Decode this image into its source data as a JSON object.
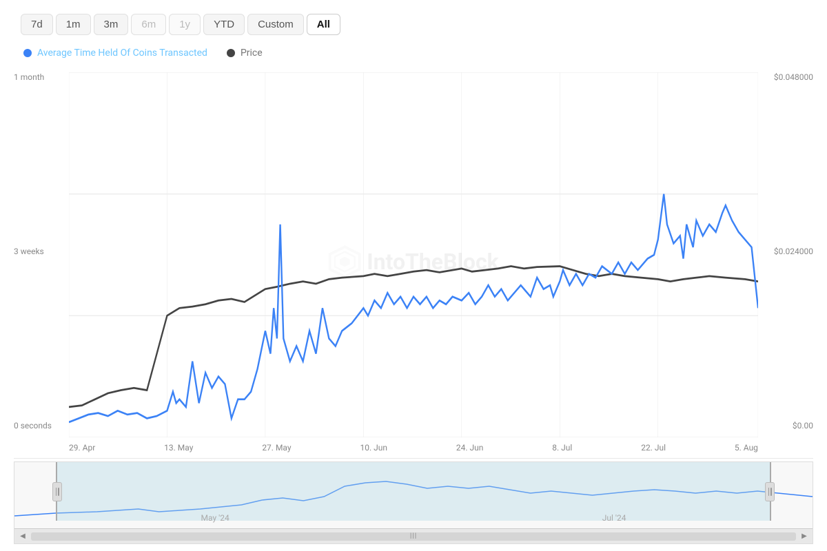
{
  "timeRange": {
    "buttons": [
      {
        "label": "7d",
        "state": "normal"
      },
      {
        "label": "1m",
        "state": "normal"
      },
      {
        "label": "3m",
        "state": "normal"
      },
      {
        "label": "6m",
        "state": "disabled"
      },
      {
        "label": "1y",
        "state": "disabled"
      },
      {
        "label": "YTD",
        "state": "normal"
      },
      {
        "label": "Custom",
        "state": "normal"
      },
      {
        "label": "All",
        "state": "active"
      }
    ]
  },
  "legend": {
    "series1_label": "Average Time Held Of Coins Transacted",
    "series2_label": "Price"
  },
  "yAxisLeft": {
    "labels": [
      "1 month",
      "3 weeks",
      "0 seconds"
    ]
  },
  "yAxisRight": {
    "labels": [
      "$0.048000",
      "$0.024000",
      "$0.00"
    ]
  },
  "xAxisLabels": [
    "29. Apr",
    "13. May",
    "27. May",
    "10. Jun",
    "24. Jun",
    "8. Jul",
    "22. Jul",
    "5. Aug"
  ],
  "navigatorLabels": [
    "May '24",
    "Jul '24"
  ],
  "watermark": "IntoTheBlock"
}
